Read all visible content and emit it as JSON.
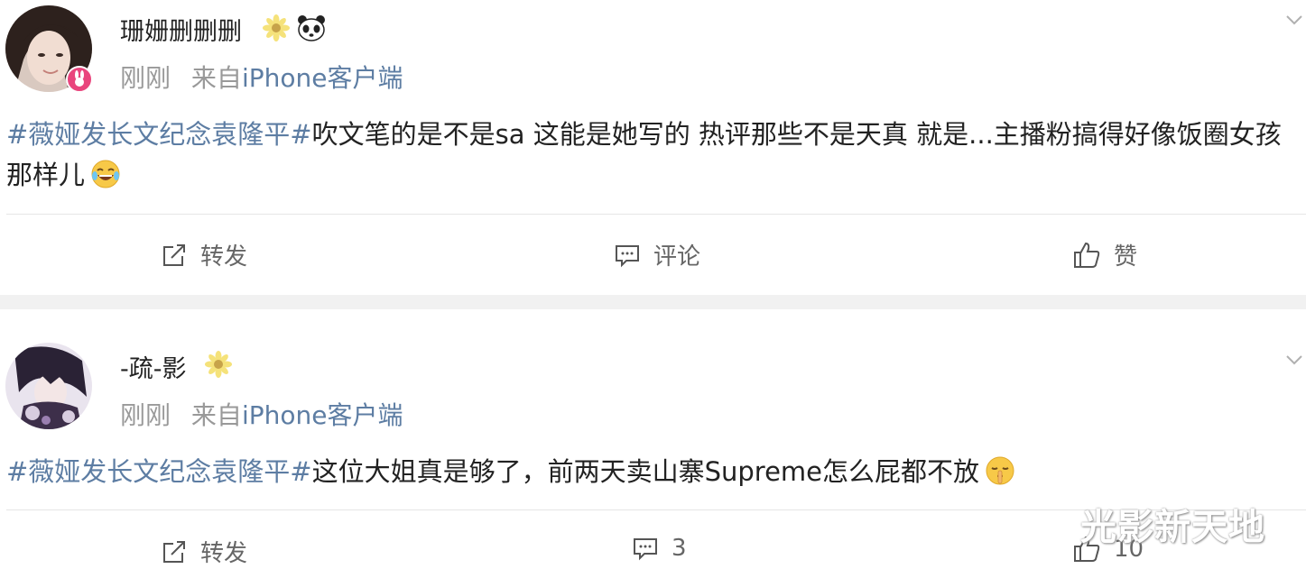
{
  "posts": [
    {
      "username": "珊姗删删删",
      "badges": [
        "sunflower-icon",
        "panda-icon"
      ],
      "time": "刚刚",
      "from_prefix": "来自",
      "source": "iPhone客户端",
      "topic": "#薇娅发长文纪念袁隆平#",
      "text": "吹文笔的是不是sa 这能是她写的 热评那些不是天真 就是...主播粉搞得好像饭圈女孩那样儿",
      "emoji": "laughing-crying-emoji",
      "actions": {
        "repost": "转发",
        "comment": "评论",
        "like": "赞"
      }
    },
    {
      "username": "-疏-影",
      "badges": [
        "sunflower-icon"
      ],
      "time": "刚刚",
      "from_prefix": "来自",
      "source": "iPhone客户端",
      "topic": "#薇娅发长文纪念袁隆平#",
      "text": "这位大姐真是够了，前两天卖山寨Supreme怎么屁都不放",
      "emoji": "shush-emoji",
      "actions": {
        "repost": "转发",
        "comment": "3",
        "like": "10"
      }
    }
  ],
  "watermark": "光影新天地",
  "colors": {
    "link": "#5d7da3",
    "meta": "#999999",
    "separator": "#f1f1f1",
    "vip_badge": "#e9457d"
  }
}
